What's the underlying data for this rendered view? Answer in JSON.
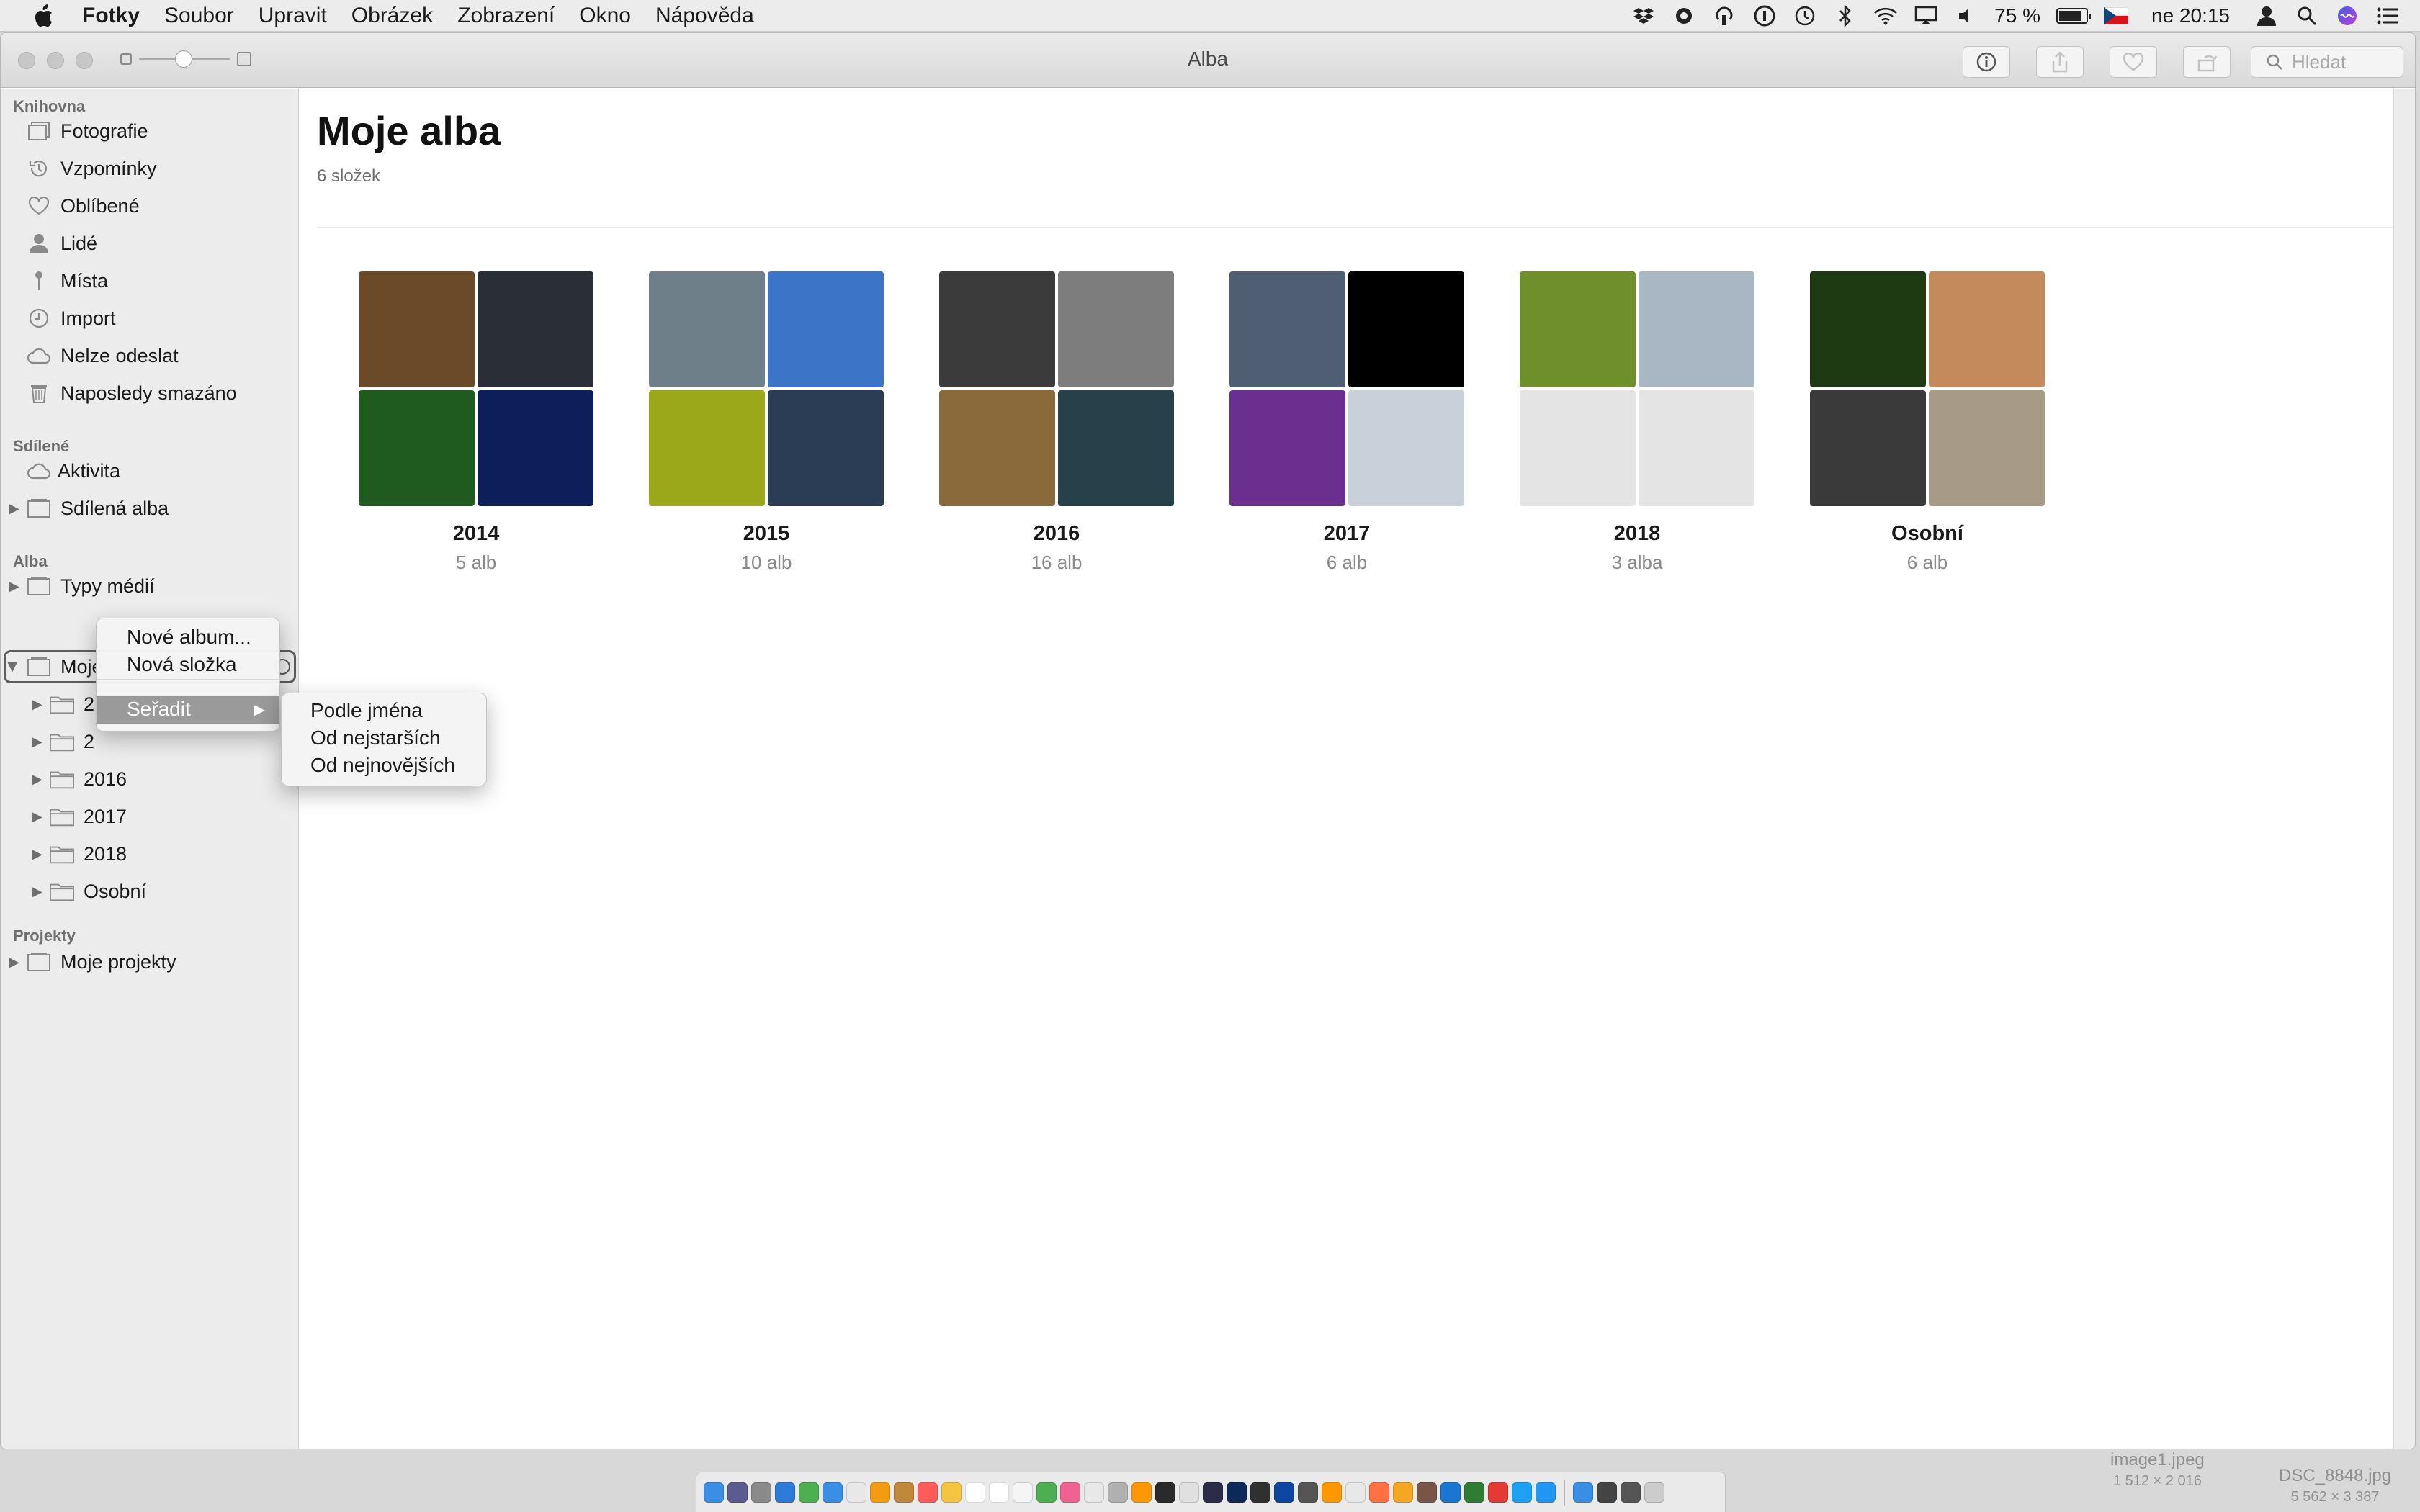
{
  "menubar": {
    "app_name": "Fotky",
    "items": [
      "Soubor",
      "Upravit",
      "Obrázek",
      "Zobrazení",
      "Okno",
      "Nápověda"
    ],
    "status": {
      "battery": "75 %",
      "battery_level": 0.75,
      "clock": "ne 20:15"
    }
  },
  "window": {
    "title": "Alba",
    "search_placeholder": "Hledat"
  },
  "sidebar": {
    "section_library": "Knihovna",
    "library_items": [
      {
        "label": "Fotografie",
        "icon": "photos-icon"
      },
      {
        "label": "Vzpomínky",
        "icon": "memories-icon"
      },
      {
        "label": "Oblíbené",
        "icon": "heart-icon"
      },
      {
        "label": "Lidé",
        "icon": "person-icon"
      },
      {
        "label": "Místa",
        "icon": "pin-icon"
      },
      {
        "label": "Import",
        "icon": "clock-icon"
      },
      {
        "label": "Nelze odeslat",
        "icon": "cloud-icon"
      },
      {
        "label": "Naposledy smazáno",
        "icon": "trash-icon"
      }
    ],
    "section_shared": "Sdílené",
    "shared_items": [
      {
        "label": "Aktivita",
        "icon": "cloud-icon"
      },
      {
        "label": "Sdílená alba",
        "icon": "album-icon"
      }
    ],
    "section_albums": "Alba",
    "album_items": [
      {
        "label": "Typy médií",
        "icon": "album-icon"
      },
      {
        "label": "Moje",
        "icon": "album-icon"
      }
    ],
    "folder_items": [
      "2",
      "2",
      "2016",
      "2017",
      "2018",
      "Osobní"
    ],
    "section_projects": "Projekty",
    "project_items": [
      {
        "label": "Moje projekty",
        "icon": "album-icon"
      }
    ]
  },
  "main": {
    "title": "Moje alba",
    "subtitle": "6 složek",
    "folders": [
      {
        "name": "2014",
        "count": "5 alb",
        "colors": [
          "#6b4a2a",
          "#2a2e36",
          "#1f5a1e",
          "#0d1f5a"
        ]
      },
      {
        "name": "2015",
        "count": "10 alb",
        "colors": [
          "#6f7f8a",
          "#3c74c8",
          "#9aa81a",
          "#2b3d55"
        ]
      },
      {
        "name": "2016",
        "count": "16 alb",
        "colors": [
          "#3b3b3b",
          "#7d7d7d",
          "#8a6a3a",
          "#26414a"
        ]
      },
      {
        "name": "2017",
        "count": "6 alb",
        "colors": [
          "#4f5e72",
          "#000000",
          "#6a2f8f",
          "#c8d0da"
        ]
      },
      {
        "name": "2018",
        "count": "3 alba",
        "colors": [
          "#6e8f2c",
          "#a9b7c4",
          "#e4e4e4",
          "#e4e4e4"
        ]
      },
      {
        "name": "Osobní",
        "count": "6 alb",
        "colors": [
          "#1d3a12",
          "#c48a5c",
          "#3a3a3a",
          "#a79a86"
        ]
      }
    ]
  },
  "context_menu": {
    "items": [
      "Nové album...",
      "Nová složka"
    ],
    "sort_label": "Seřadit",
    "submenu": [
      "Podle jména",
      "Od nejstarších",
      "Od nejnovějších"
    ]
  },
  "desktop": {
    "files": [
      {
        "name": "image1.jpeg",
        "dims": "1 512 × 2 016"
      },
      {
        "name": "DSC_8848.jpg",
        "dims": "5 562 × 3 387"
      }
    ]
  },
  "dock": {
    "apps": [
      "#3a8ee6",
      "#5b5b8f",
      "#8a8a8a",
      "#2d7ad9",
      "#4caf50",
      "#3a8ee6",
      "#e8e8e8",
      "#f39c12",
      "#c0883a",
      "#ff5b5b",
      "#f5c542",
      "#ffffff",
      "#ffffff",
      "#f5f5f5",
      "#4caf50",
      "#f06292",
      "#e8e8e8",
      "#b0b0b0",
      "#ff9800",
      "#2a2a2a",
      "#e0e0e0",
      "#2c2c4a",
      "#0b2a5a",
      "#303030",
      "#0d47a1",
      "#555555",
      "#ff9800",
      "#e8e8e8",
      "#ff7043",
      "#f5a623",
      "#795548",
      "#1976d2",
      "#2e7d32",
      "#e53935",
      "#1da1f2",
      "#2196f3",
      "#3a8ee6",
      "#444444",
      "#555555",
      "#cccccc"
    ]
  }
}
